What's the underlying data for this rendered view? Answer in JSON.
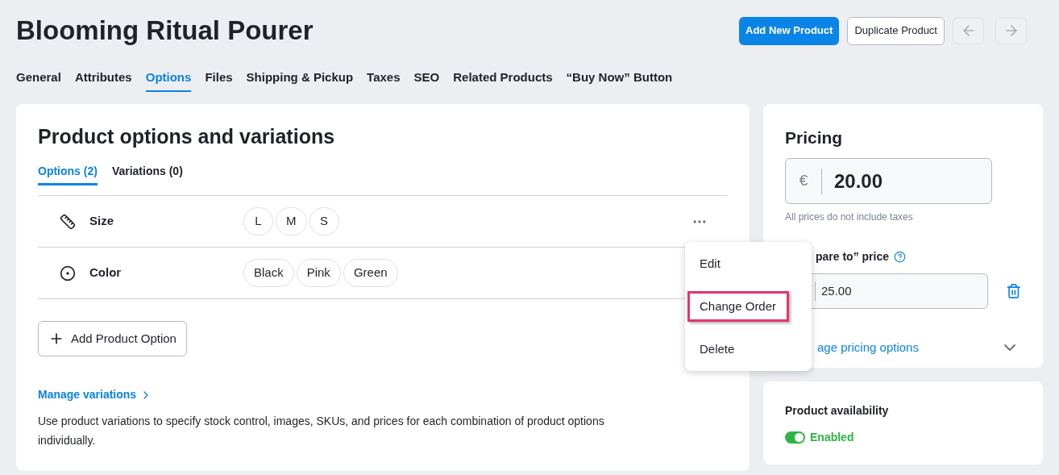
{
  "header": {
    "title": "Blooming Ritual Pourer",
    "buttons": [
      {
        "label": "Add New Product",
        "kind": "primary"
      },
      {
        "label": "Duplicate Product",
        "kind": "secondary"
      }
    ]
  },
  "tabs": [
    {
      "label": "General",
      "selected": false
    },
    {
      "label": "Attributes",
      "selected": false
    },
    {
      "label": "Options",
      "selected": true
    },
    {
      "label": "Files",
      "selected": false
    },
    {
      "label": "Shipping & Pickup",
      "selected": false
    },
    {
      "label": "Taxes",
      "selected": false
    },
    {
      "label": "SEO",
      "selected": false
    },
    {
      "label": "Related Products",
      "selected": false
    },
    {
      "label": "“Buy Now” Button",
      "selected": false
    }
  ],
  "options_card": {
    "title": "Product options and variations",
    "subtabs": [
      {
        "label": "Options (2)",
        "selected": true
      },
      {
        "label": "Variations (0)",
        "selected": false
      }
    ],
    "options": [
      {
        "name": "Size",
        "kind": "ruler",
        "values": [
          "L",
          "M",
          "S"
        ],
        "menu": {
          "items": [
            {
              "label": "Edit",
              "highlighted": false
            },
            {
              "label": "Change Order",
              "highlighted": true
            },
            {
              "label": "Delete",
              "highlighted": false
            }
          ]
        }
      },
      {
        "name": "Color",
        "kind": "radio",
        "values": [
          "Black",
          "Pink",
          "Green"
        ]
      }
    ],
    "add_button": "Add Product Option",
    "manage_link": "Manage variations",
    "description": "Use product variations to specify stock control, images, SKUs, and prices for each combination of product options individually."
  },
  "pricing": {
    "title": "Pricing",
    "currency": "€",
    "price": "20.00",
    "note": "All prices do not include taxes",
    "compare_label": "pare to” price",
    "compare_value": "25.00",
    "manage_link": "age pricing options"
  },
  "availability": {
    "title": "Product availability",
    "on": true,
    "status": "Enabled"
  }
}
